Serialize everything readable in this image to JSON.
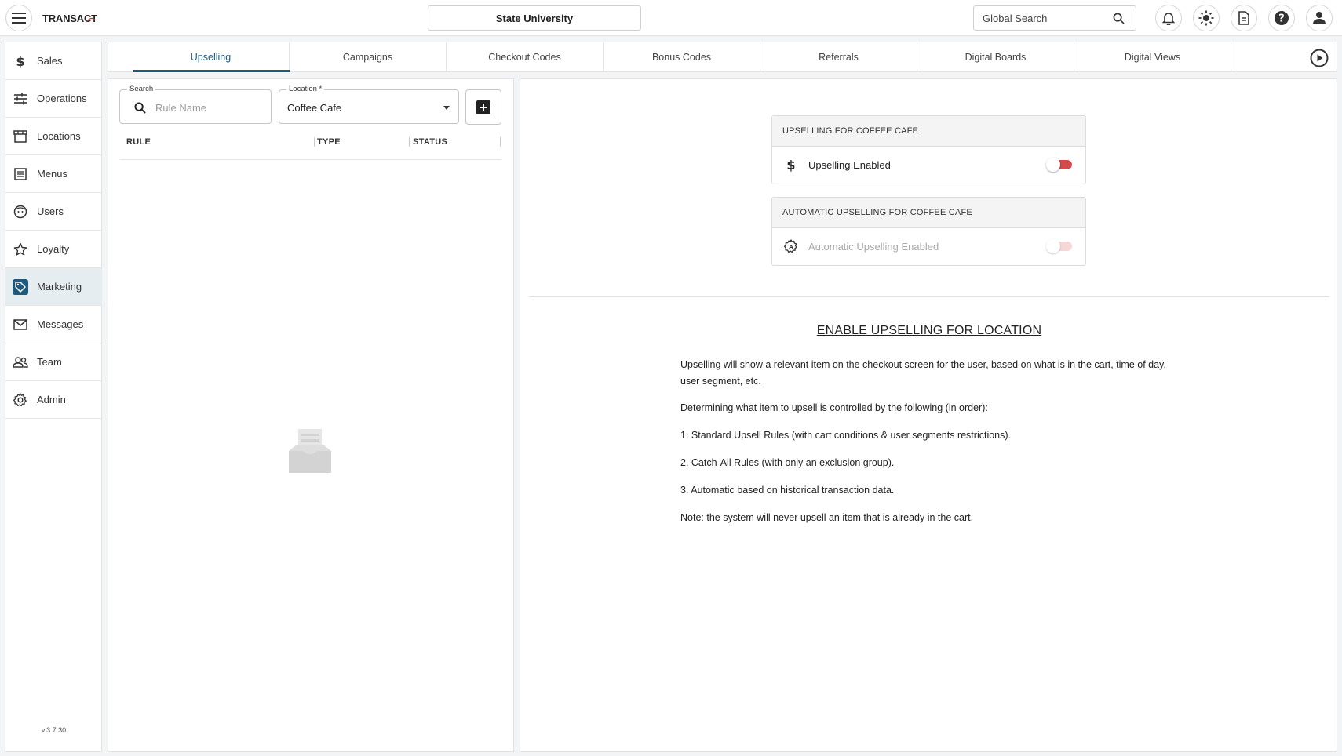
{
  "app": {
    "brand": "TRANSACT",
    "organization": "State University",
    "global_search_placeholder": "Global Search",
    "version": "v.3.7.30"
  },
  "sidebar": {
    "items": [
      {
        "label": "Sales",
        "icon": "dollar-icon"
      },
      {
        "label": "Operations",
        "icon": "sliders-icon"
      },
      {
        "label": "Locations",
        "icon": "storefront-icon"
      },
      {
        "label": "Menus",
        "icon": "menu-list-icon"
      },
      {
        "label": "Users",
        "icon": "face-icon"
      },
      {
        "label": "Loyalty",
        "icon": "star-icon"
      },
      {
        "label": "Marketing",
        "icon": "tag-icon",
        "active": true
      },
      {
        "label": "Messages",
        "icon": "mail-icon"
      },
      {
        "label": "Team",
        "icon": "people-icon"
      },
      {
        "label": "Admin",
        "icon": "gear-icon"
      }
    ]
  },
  "tabs": [
    {
      "label": "Upselling",
      "active": true
    },
    {
      "label": "Campaigns"
    },
    {
      "label": "Checkout Codes"
    },
    {
      "label": "Bonus Codes"
    },
    {
      "label": "Referrals"
    },
    {
      "label": "Digital Boards"
    },
    {
      "label": "Digital Views"
    }
  ],
  "rules_panel": {
    "search_label": "Search",
    "search_placeholder": "Rule Name",
    "location_label": "Location *",
    "location_value": "Coffee Cafe",
    "columns": [
      "RULE",
      "TYPE",
      "STATUS"
    ]
  },
  "settings": {
    "upselling_card": {
      "title": "UPSELLING FOR COFFEE CAFE",
      "label": "Upselling Enabled",
      "enabled": false
    },
    "auto_card": {
      "title": "AUTOMATIC UPSELLING FOR COFFEE CAFE",
      "label": "Automatic Upselling Enabled",
      "enabled": false,
      "disabled": true
    }
  },
  "info": {
    "title": "ENABLE UPSELLING FOR LOCATION",
    "paragraphs": [
      "Upselling will show a relevant item on the checkout screen for the user, based on what is in the cart, time of day, user segment, etc.",
      "Determining what item to upsell is controlled by the following (in order):",
      "1. Standard Upsell Rules (with cart conditions & user segments restrictions).",
      "2. Catch-All Rules (with only an exclusion group).",
      "3. Automatic based on historical transaction data.",
      "Note: the system will never upsell an item that is already in the cart."
    ]
  },
  "colors": {
    "accent": "#1d5a7e",
    "toggle_off_track": "#d34a4a",
    "toggle_disabled_track": "#f6d6d6"
  }
}
